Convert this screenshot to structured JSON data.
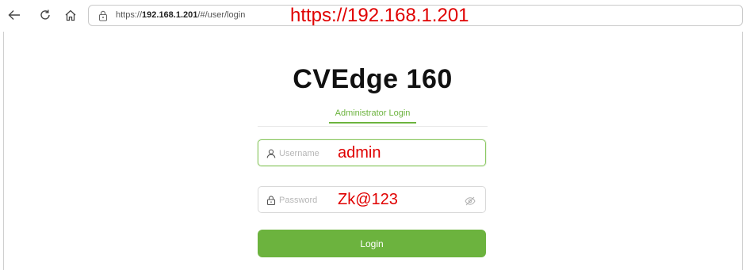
{
  "browser": {
    "url_prefix": "https://",
    "url_host": "192.168.1.201",
    "url_path": "/#/user/login",
    "url_annotation": "https://192.168.1.201"
  },
  "login": {
    "title": "CVEdge 160",
    "tab_label": "Administrator Login",
    "username_placeholder": "Username",
    "username_annotation": "admin",
    "password_placeholder": "Password",
    "password_annotation": "Zk@123",
    "button_label": "Login"
  },
  "colors": {
    "accent": "#6cb33e",
    "annotation": "#e00000"
  },
  "icons": [
    "back-icon",
    "reload-icon",
    "home-icon",
    "site-info-icon",
    "user-icon",
    "lock-icon",
    "eye-off-icon"
  ]
}
